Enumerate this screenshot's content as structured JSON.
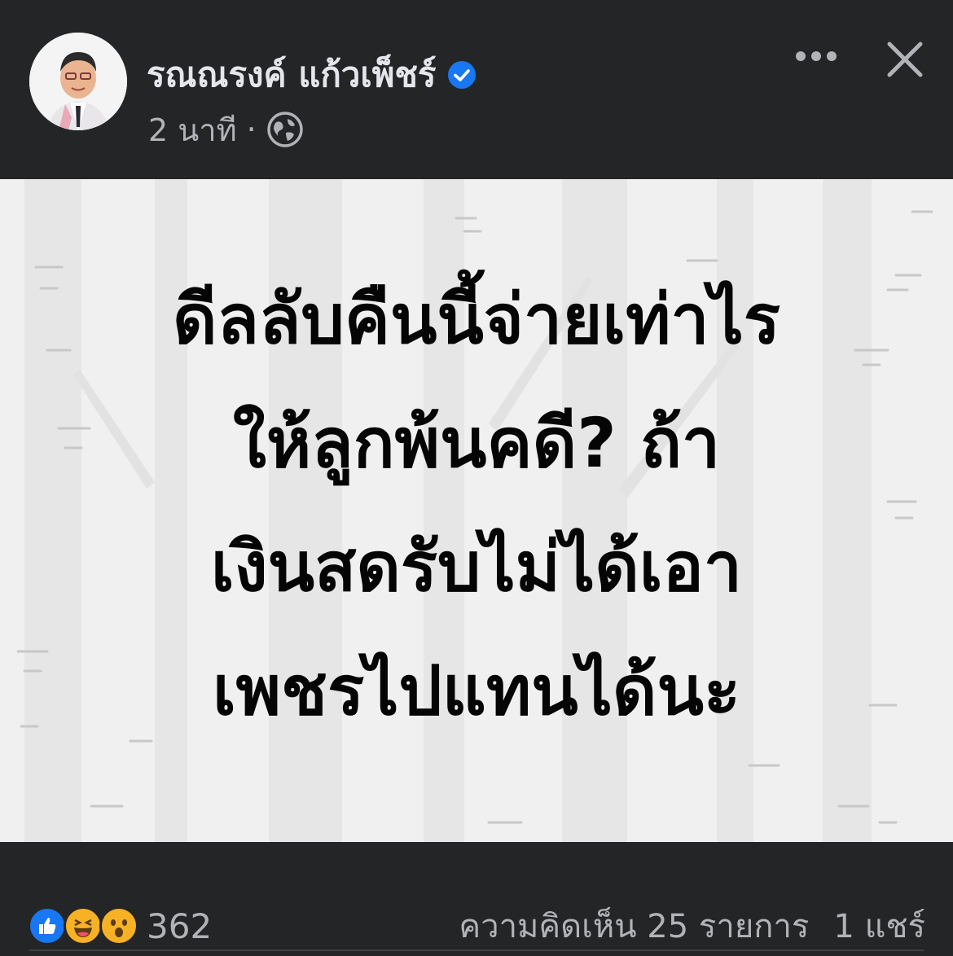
{
  "post": {
    "author_name": "รณณรงค์ แก้วเพ็ชร์",
    "timestamp": "2 นาที",
    "separator": "·",
    "privacy_icon": "globe-icon",
    "verified_icon": "verified-badge-icon",
    "more_icon": "more-options-icon",
    "close_icon": "close-icon",
    "text_lines": [
      "ดีลลับคืนนี้จ่ายเท่าไร",
      "ให้ลูกพ้นคดี? ถ้า",
      "เงินสดรับไม่ได้เอา",
      "เพชรไปแทนได้นะ"
    ]
  },
  "engagement": {
    "reaction_icons": [
      "like-icon",
      "haha-icon",
      "wow-icon"
    ],
    "reaction_count": "362",
    "comments": "ความคิดเห็น 25 รายการ",
    "shares": "1 แชร์"
  },
  "colors": {
    "background": "#242526",
    "text_primary": "#e4e6eb",
    "text_secondary": "#b0b3b8",
    "post_background": "#f0f0f0",
    "verified": "#1877f2",
    "like": "#1877f2",
    "haha": "#f7b125"
  }
}
